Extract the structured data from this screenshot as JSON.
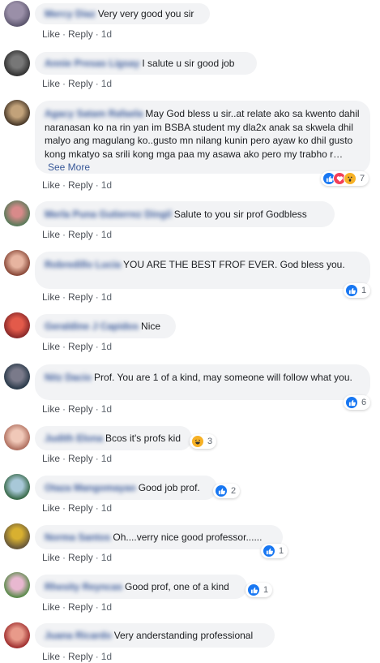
{
  "actions": {
    "like": "Like",
    "reply": "Reply",
    "time": "1d"
  },
  "see_more": "See More",
  "comments": [
    {
      "name": "Mercy Diaz",
      "text": "Very very good you sir"
    },
    {
      "name": "Annie Presas Ligsay",
      "text": "I salute u sir good job"
    },
    {
      "name": "Agacy Satam Rafaela",
      "text": "May God bless u sir..at relate ako sa kwento dahil naranasan ko na rin yan im BSBA student my dla2x anak sa skwela dhil malyo ang magulang ko..gusto mn nilang kunin pero ayaw ko dhil gusto kong mkatyo sa srili kong mga paa my asawa ako pero my trabho r…",
      "reactions": [
        "like",
        "love",
        "wow"
      ],
      "reaction_count": "7"
    },
    {
      "name": "Merla Puna Gutierrez Dingil",
      "text": "Salute to you sir prof Godbless"
    },
    {
      "name": "Robredillo Lucia",
      "text": "YOU ARE THE BEST FROF EVER. God bless you.",
      "reactions": [
        "like"
      ],
      "reaction_count": "1"
    },
    {
      "name": "Geraldine J Capidos",
      "text": "Nice"
    },
    {
      "name": "Nitz Dacio",
      "text": "Prof. You are 1 of a kind, may someone will follow what you.",
      "reactions": [
        "like"
      ],
      "reaction_count": "6"
    },
    {
      "name": "Judith Elona",
      "text": "Bcos it's profs kid",
      "reactions": [
        "haha"
      ],
      "reaction_count": "3"
    },
    {
      "name": "Otaza Mangomayao",
      "text": "Good job prof.",
      "reactions": [
        "like"
      ],
      "reaction_count": "2"
    },
    {
      "name": "Norma Santos",
      "text": "Oh....verry nice good professor......",
      "reactions": [
        "like"
      ],
      "reaction_count": "1"
    },
    {
      "name": "Rhesity Reyncas",
      "text": "Good prof, one of a kind",
      "reactions": [
        "like"
      ],
      "reaction_count": "1"
    },
    {
      "name": "Juana Ricardo",
      "text": "Very anderstanding professional"
    }
  ]
}
